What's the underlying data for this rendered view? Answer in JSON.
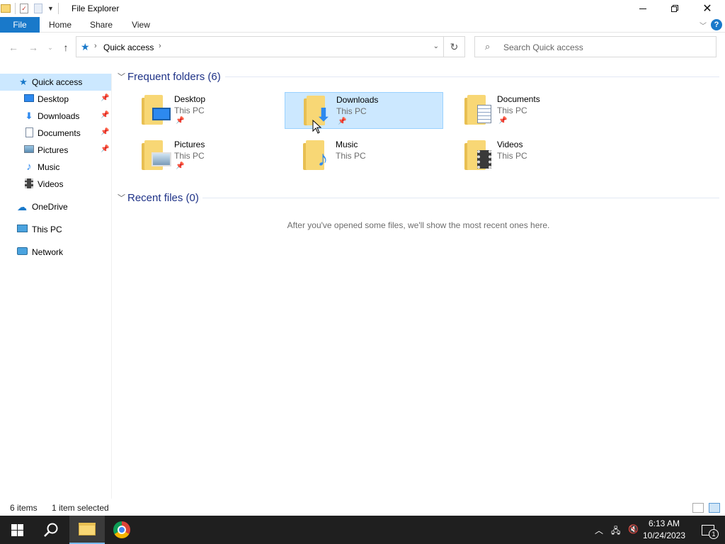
{
  "window": {
    "title": "File Explorer"
  },
  "ribbon": {
    "tabs": [
      "File",
      "Home",
      "Share",
      "View"
    ],
    "help": "?"
  },
  "address": {
    "location": "Quick access"
  },
  "search": {
    "placeholder": "Search Quick access"
  },
  "nav": {
    "items": [
      {
        "label": "Quick access",
        "icon": "star-icon",
        "selected": true
      },
      {
        "label": "Desktop",
        "icon": "desktop-icon",
        "pinned": true
      },
      {
        "label": "Downloads",
        "icon": "download-arrow-icon",
        "pinned": true
      },
      {
        "label": "Documents",
        "icon": "documents-icon",
        "pinned": true
      },
      {
        "label": "Pictures",
        "icon": "pictures-icon",
        "pinned": true
      },
      {
        "label": "Music",
        "icon": "music-note-icon"
      },
      {
        "label": "Videos",
        "icon": "film-icon"
      },
      {
        "label": "OneDrive",
        "icon": "cloud-icon"
      },
      {
        "label": "This PC",
        "icon": "computer-icon"
      },
      {
        "label": "Network",
        "icon": "network-icon"
      }
    ]
  },
  "frequent": {
    "title": "Frequent folders (6)",
    "folders": [
      {
        "name": "Desktop",
        "location": "This PC",
        "pinned": true,
        "overlay": "desktop-icon"
      },
      {
        "name": "Downloads",
        "location": "This PC",
        "pinned": true,
        "selected": true,
        "overlay": "download-arrow-icon"
      },
      {
        "name": "Documents",
        "location": "This PC",
        "pinned": true,
        "overlay": "documents-icon"
      },
      {
        "name": "Pictures",
        "location": "This PC",
        "pinned": true,
        "overlay": "pictures-icon"
      },
      {
        "name": "Music",
        "location": "This PC",
        "pinned": false,
        "overlay": "music-note-icon"
      },
      {
        "name": "Videos",
        "location": "This PC",
        "pinned": false,
        "overlay": "film-icon"
      }
    ]
  },
  "recent": {
    "title": "Recent files (0)",
    "empty_message": "After you've opened some files, we'll show the most recent ones here."
  },
  "status": {
    "items": "6 items",
    "selected": "1 item selected"
  },
  "taskbar": {
    "time": "6:13 AM",
    "date": "10/24/2023",
    "notifications": "1"
  },
  "colors": {
    "accent": "#1979ca",
    "selection": "#cce8ff",
    "section_title": "#1e3287",
    "taskbar": "#1f1f1f"
  }
}
